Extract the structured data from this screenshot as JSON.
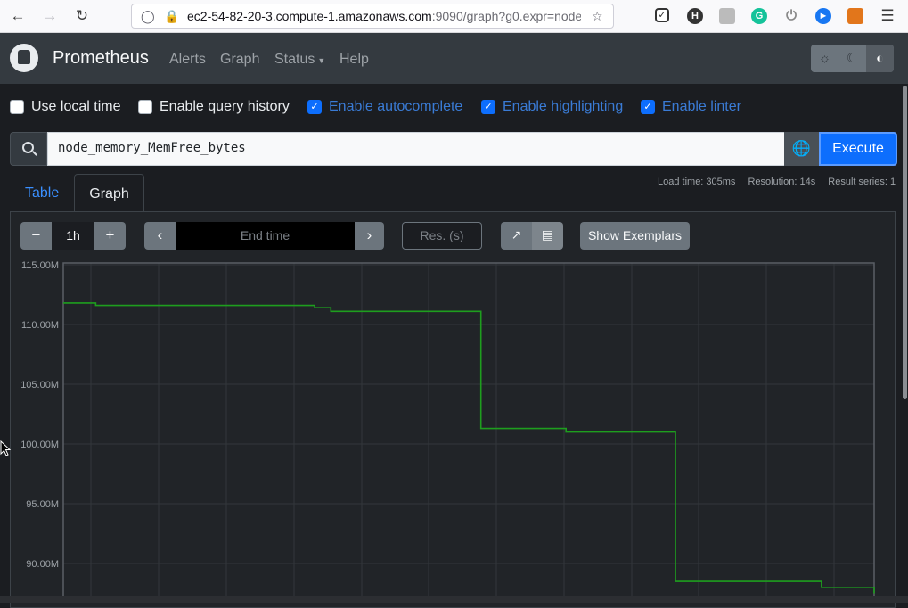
{
  "browser": {
    "back_icon": "arrow-left-icon",
    "forward_icon": "arrow-right-icon",
    "reload_icon": "reload-icon",
    "url_host": "ec2-54-82-20-3.compute-1.amazonaws.com",
    "url_rest": ":9090/graph?g0.expr=node",
    "menu_icon": "hamburger-menu-icon"
  },
  "navbar": {
    "brand": "Prometheus",
    "links": [
      "Alerts",
      "Graph",
      "Status",
      "Help"
    ]
  },
  "options": {
    "local_time": "Use local time",
    "query_history": "Enable query history",
    "autocomplete": "Enable autocomplete",
    "highlighting": "Enable highlighting",
    "linter": "Enable linter",
    "checked": [
      false,
      false,
      true,
      true,
      true
    ]
  },
  "query": {
    "expression": "node_memory_MemFree_bytes",
    "execute_label": "Execute"
  },
  "tabs": {
    "table": "Table",
    "graph": "Graph",
    "active": "Graph"
  },
  "stats": {
    "load_time": "Load time: 305ms",
    "resolution": "Resolution: 14s",
    "result_series": "Result series: 1"
  },
  "graph_controls": {
    "decrease": "−",
    "range": "1h",
    "increase": "+",
    "end_time_placeholder": "End time",
    "res_placeholder": "Res. (s)",
    "show_exemplars": "Show Exemplars"
  },
  "colors": {
    "series_line": "#1e9e1e",
    "accent": "#0d6efd"
  },
  "chart_data": {
    "type": "line",
    "ylim": [
      88,
      115
    ],
    "yticks": [
      {
        "label": "115.00M",
        "value": 115
      },
      {
        "label": "110.00M",
        "value": 110
      },
      {
        "label": "105.00M",
        "value": 105
      },
      {
        "label": "100.00M",
        "value": 100
      },
      {
        "label": "95.00M",
        "value": 95
      },
      {
        "label": "90.00M",
        "value": 90
      }
    ],
    "x": [
      0,
      0.035,
      0.04,
      0.3,
      0.31,
      0.325,
      0.33,
      0.51,
      0.515,
      0.615,
      0.62,
      0.75,
      0.755,
      0.93,
      0.935,
      0.975,
      1.0
    ],
    "series": [
      {
        "values": [
          111.8,
          111.8,
          111.6,
          111.6,
          111.4,
          111.4,
          111.1,
          111.1,
          101.3,
          101.3,
          101.0,
          101.0,
          88.5,
          88.5,
          88.0,
          88.0,
          87.5
        ]
      }
    ],
    "grid": true
  }
}
